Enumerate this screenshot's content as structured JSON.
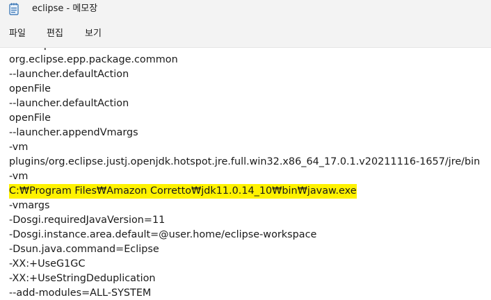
{
  "window": {
    "title": "eclipse - 메모장"
  },
  "menu": {
    "file": "파일",
    "edit": "편집",
    "view": "보기"
  },
  "editor": {
    "lines": [
      "-showsplash",
      "org.eclipse.epp.package.common",
      "--launcher.defaultAction",
      "openFile",
      "--launcher.defaultAction",
      "openFile",
      "--launcher.appendVmargs",
      "-vm",
      "plugins/org.eclipse.justj.openjdk.hotspot.jre.full.win32.x86_64_17.0.1.v20211116-1657/jre/bin",
      "-vm",
      "C:₩Program Files₩Amazon Corretto₩jdk11.0.14_10₩bin₩javaw.exe",
      "-vmargs",
      "-Dosgi.requiredJavaVersion=11",
      "-Dosgi.instance.area.default=@user.home/eclipse-workspace",
      "-Dsun.java.command=Eclipse",
      "-XX:+UseG1GC",
      "-XX:+UseStringDeduplication",
      "--add-modules=ALL-SYSTEM"
    ],
    "highlight_color": "#fff200"
  },
  "icons": {
    "app": "notepad-icon"
  }
}
